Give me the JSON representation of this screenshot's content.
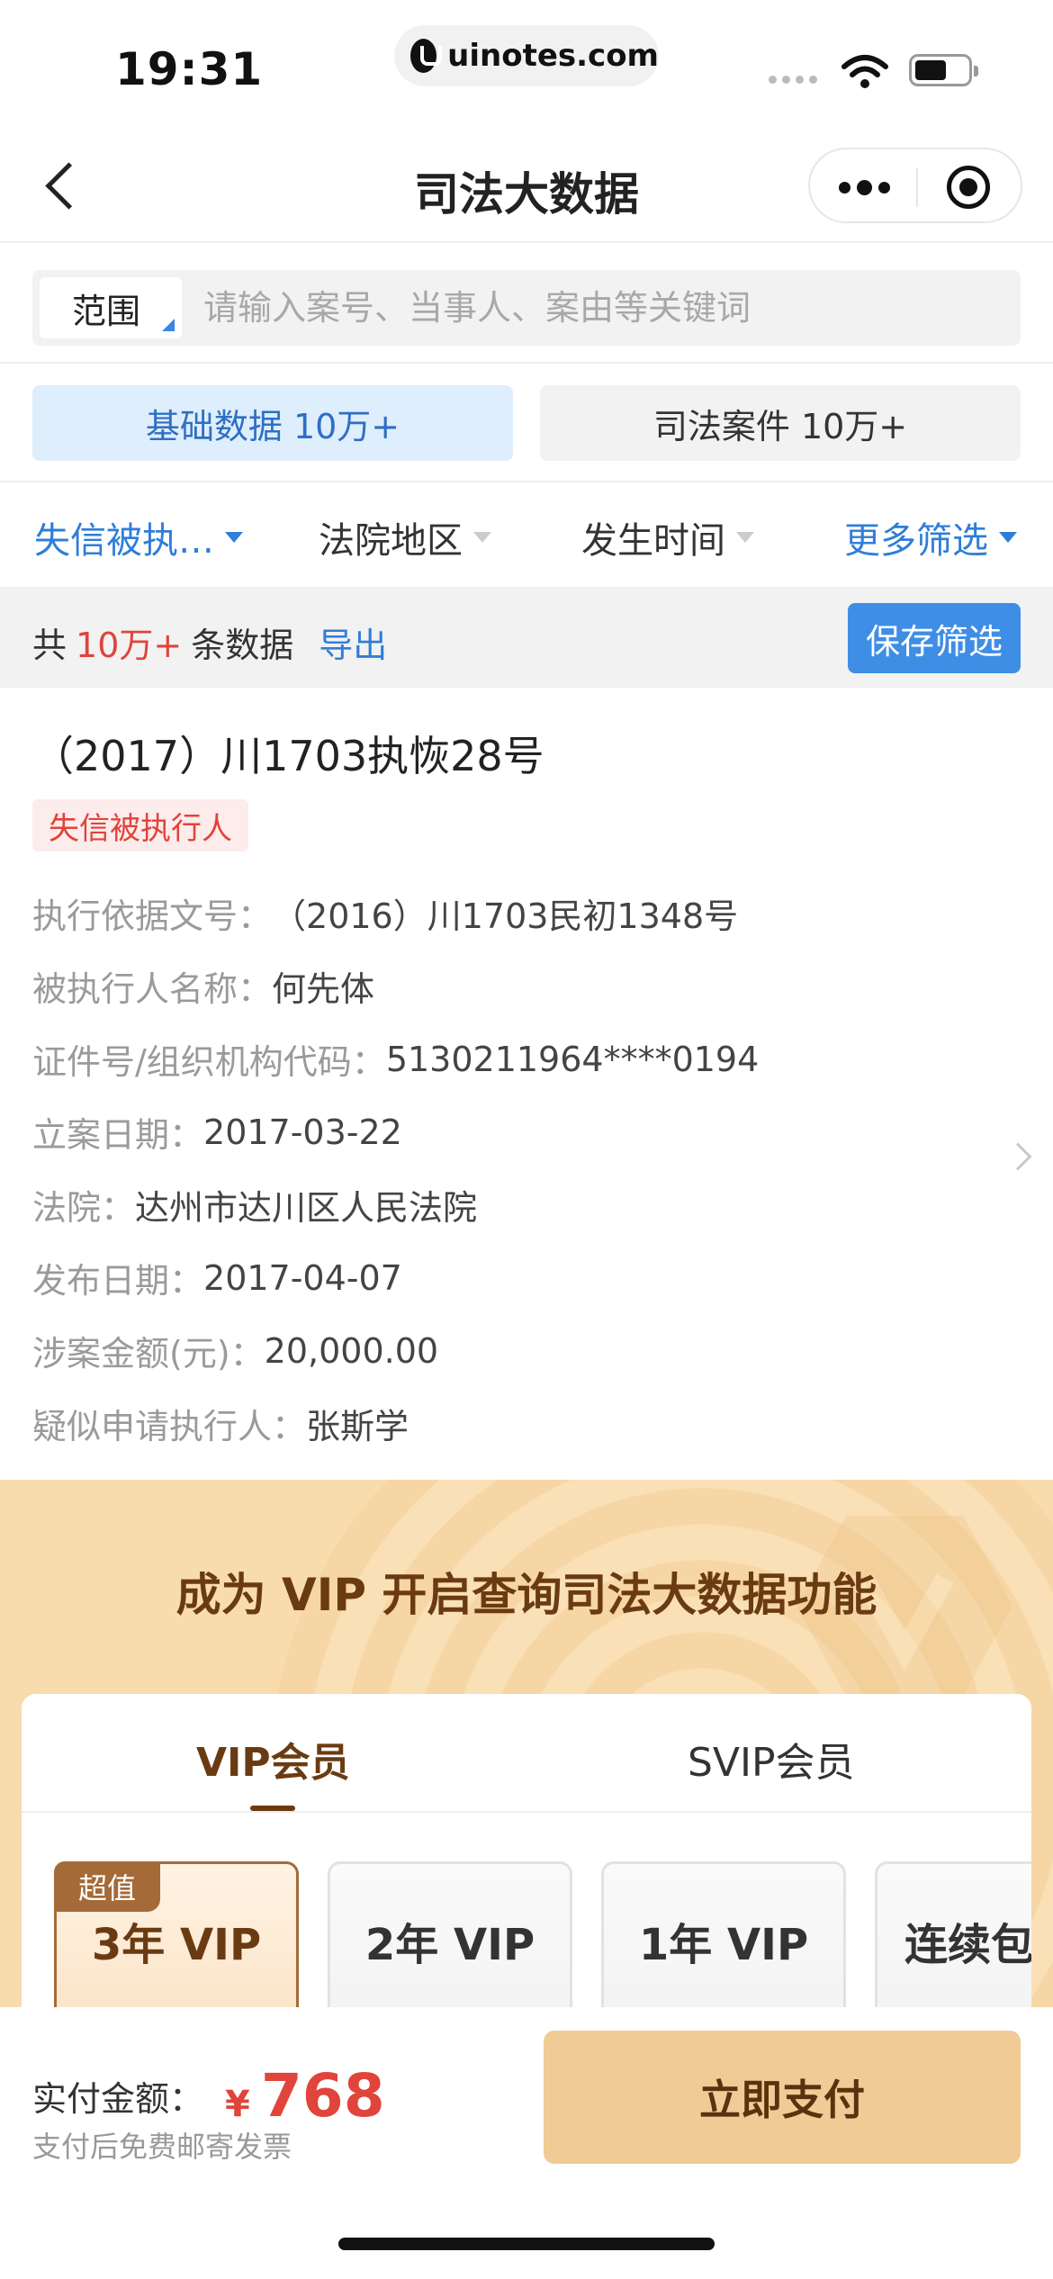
{
  "status_bar": {
    "time": "19:31",
    "url": "uinotes.com",
    "battery_level": 0.6
  },
  "nav": {
    "title": "司法大数据",
    "back_icon": "chevron-left-icon",
    "more_icon": "more-dots-icon",
    "close_icon": "target-close-icon"
  },
  "search": {
    "scope_label": "范围",
    "placeholder": "请输入案号、当事人、案由等关键词"
  },
  "data_tabs": [
    {
      "label": "基础数据 10万+",
      "active": true
    },
    {
      "label": "司法案件 10万+",
      "active": false
    }
  ],
  "filters": [
    {
      "label": "失信被执…",
      "active": true
    },
    {
      "label": "法院地区",
      "active": false
    },
    {
      "label": "发生时间",
      "active": false
    },
    {
      "label": "更多筛选",
      "active": true
    }
  ],
  "summary": {
    "prefix": "共",
    "count": "10万+",
    "suffix": "条数据",
    "export": "导出",
    "save_filter": "保存筛选"
  },
  "record": {
    "title": "（2017）川1703执恢28号",
    "tag": "失信被执行人",
    "fields": [
      {
        "key": "执行依据文号：",
        "value": "（2016）川1703民初1348号"
      },
      {
        "key": "被执行人名称：",
        "value": "何先体"
      },
      {
        "key": "证件号/组织机构代码：",
        "value": "5130211964****0194"
      },
      {
        "key": "立案日期：",
        "value": "2017-03-22"
      },
      {
        "key": "法院：",
        "value": "达州市达川区人民法院"
      },
      {
        "key": "发布日期：",
        "value": "2017-04-07"
      },
      {
        "key": "涉案金额(元)：",
        "value": "20,000.00"
      },
      {
        "key": "疑似申请执行人：",
        "value": "张斯学"
      }
    ]
  },
  "vip": {
    "headline": "成为 VIP 开启查询司法大数据功能",
    "tabs": [
      {
        "label": "VIP会员",
        "active": true
      },
      {
        "label": "SVIP会员",
        "active": false
      }
    ],
    "plans": [
      {
        "name": "3年 VIP",
        "badge": "超值",
        "selected": true
      },
      {
        "name": "2年 VIP",
        "selected": false
      },
      {
        "name": "1年 VIP",
        "selected": false
      },
      {
        "name": "连续包",
        "selected": false
      }
    ]
  },
  "payment": {
    "label": "实付金额：",
    "currency": "¥",
    "amount": "768",
    "note": "支付后免费邮寄发票",
    "button": "立即支付"
  },
  "colors": {
    "accent_blue": "#2f7ed8",
    "red": "#e0443a",
    "vip_brown": "#6a3b12",
    "pay_button": "#f1cb95"
  }
}
